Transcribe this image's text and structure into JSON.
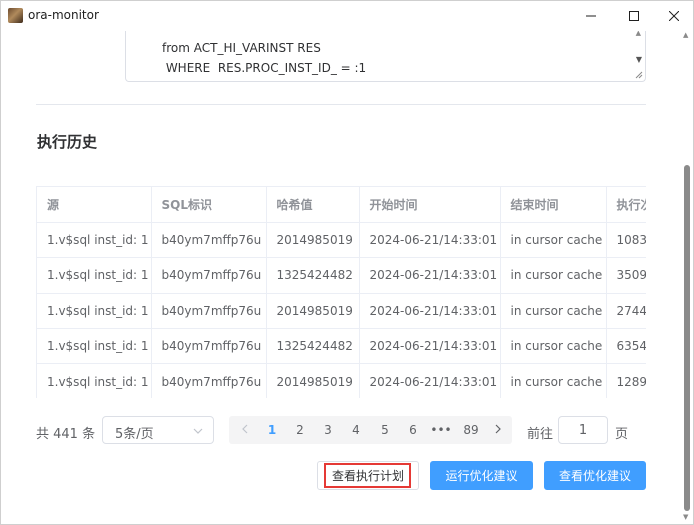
{
  "window": {
    "title": "ora-monitor",
    "icon": "app-logo-icon"
  },
  "sql": {
    "line1": "from ACT_HI_VARINST RES",
    "line2": " WHERE  RES.PROC_INST_ID_ = :1"
  },
  "history": {
    "title": "执行历史",
    "columns": [
      "源",
      "SQL标识",
      "哈希值",
      "开始时间",
      "结束时间",
      "执行次"
    ],
    "rows": [
      [
        "1.v$sql inst_id: 1",
        "b40ym7mffp76u",
        "2014985019",
        "2024-06-21/14:33:01",
        "in cursor cache",
        "1083"
      ],
      [
        "1.v$sql inst_id: 1",
        "b40ym7mffp76u",
        "1325424482",
        "2024-06-21/14:33:01",
        "in cursor cache",
        "3509"
      ],
      [
        "1.v$sql inst_id: 1",
        "b40ym7mffp76u",
        "2014985019",
        "2024-06-21/14:33:01",
        "in cursor cache",
        "2744"
      ],
      [
        "1.v$sql inst_id: 1",
        "b40ym7mffp76u",
        "1325424482",
        "2024-06-21/14:33:01",
        "in cursor cache",
        "6354"
      ],
      [
        "1.v$sql inst_id: 1",
        "b40ym7mffp76u",
        "2014985019",
        "2024-06-21/14:33:01",
        "in cursor cache",
        "1289"
      ]
    ]
  },
  "pagination": {
    "total": "共 441 条",
    "page_size": "5条/页",
    "pages": [
      "1",
      "2",
      "3",
      "4",
      "5",
      "6",
      "•••",
      "89"
    ],
    "current_page": "1",
    "goto_label": "前往",
    "goto_value": "1",
    "page_suffix": "页"
  },
  "actions": {
    "view_plan": "查看执行计划",
    "run_advice": "运行优化建议",
    "view_advice": "查看优化建议"
  },
  "colors": {
    "primary": "#409eff",
    "highlight": "#e53935"
  }
}
